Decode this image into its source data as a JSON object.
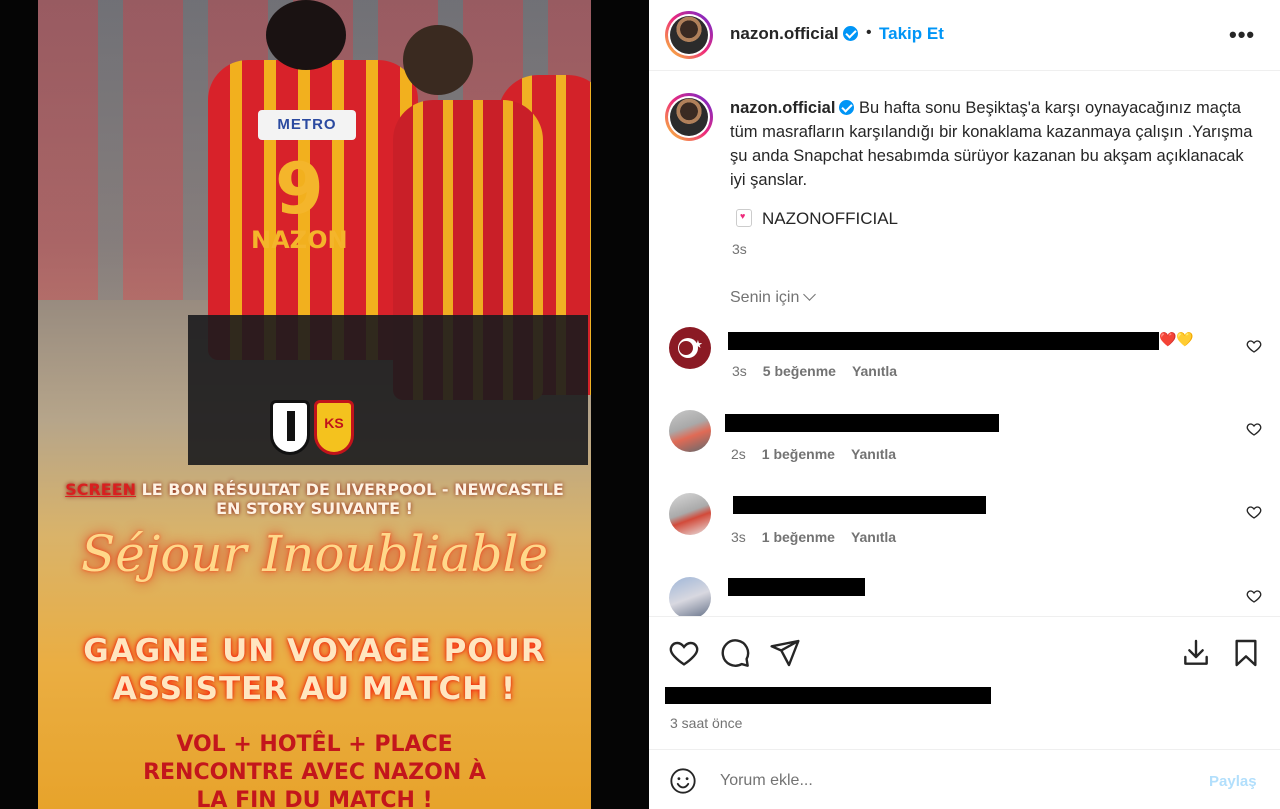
{
  "story": {
    "sponsor": "METRO",
    "jersey_number": "9",
    "jersey_name": "NAZON",
    "crest_ks": "KS",
    "screen_word": "SCREEN",
    "screen_rest_line1": " LE BON RÉSULTAT DE LIVERPOOL - NEWCASTLE",
    "screen_line2": "EN STORY SUIVANTE !",
    "headline": "Séjour Inoubliable",
    "gagne_line1": "GAGNE UN VOYAGE POUR",
    "gagne_line2": "ASSISTER AU MATCH !",
    "vol_line1": "VOL + HOTÊL + PLACE",
    "vol_line2": "RENCONTRE AVEC NAZON À",
    "vol_line3": "LA FIN DU MATCH !"
  },
  "header": {
    "username": "nazon.official",
    "dot": "•",
    "follow_label": "Takip Et",
    "more_label": "•••"
  },
  "caption": {
    "username": "nazon.official",
    "text": "Bu hafta sonu Beşiktaş'a karşı oynayacağınız maçta tüm masrafların karşılandığı bir konaklama kazanmaya çalışın .Yarışma şu anda Snapchat hesabımda sürüyor kazanan bu akşam açıklanacak iyi şanslar.",
    "snapchat": "NAZONOFFICIAL",
    "time": "3s"
  },
  "senin_label": "Senin için",
  "comments": [
    {
      "hearts": "❤️💛",
      "time": "3s",
      "likes": "5 beğenme",
      "reply": "Yanıtla"
    },
    {
      "hearts": "",
      "time": "2s",
      "likes": "1 beğenme",
      "reply": "Yanıtla"
    },
    {
      "hearts": "",
      "time": "3s",
      "likes": "1 beğenme",
      "reply": "Yanıtla"
    },
    {
      "hearts": "",
      "time": "",
      "likes": "",
      "reply": ""
    }
  ],
  "actions": {
    "posted": "3 saat önce"
  },
  "comment_bar": {
    "placeholder": "Yorum ekle...",
    "share_label": "Paylaş"
  },
  "colors": {
    "accent": "#0095f6",
    "muted": "#737373",
    "jersey_red": "#d8222a",
    "jersey_gold": "#f2b01e"
  }
}
